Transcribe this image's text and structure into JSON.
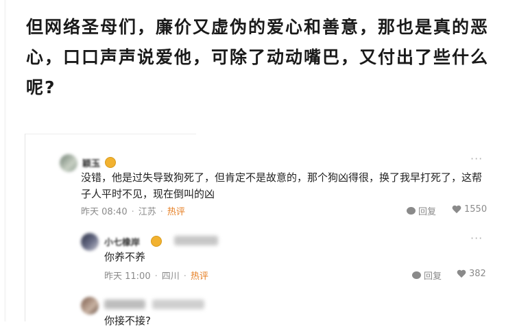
{
  "headline": "但网络圣母们，廉价又虚伪的爱心和善意，那也是真的恶心，口口声声说爱他，可除了动动嘴巴，又付出了些什么呢?",
  "comment1": {
    "name": "颖玉",
    "text": "没错，他是过失导致狗死了，但肯定不是故意的，那个狗凶得很，换了我早打死了，这帮子人平时不见，现在倒叫的凶",
    "time": "昨天 08:40",
    "location": "江苏",
    "hot": "热评",
    "reply_label": "回复",
    "likes": "1550"
  },
  "reply1": {
    "name": "小七橡岸",
    "text": "你养不养",
    "time": "昨天 11:00",
    "location": "四川",
    "hot": "热评",
    "reply_label": "回复",
    "likes": "382"
  },
  "reply2": {
    "text": "你接不接?"
  },
  "more_icon": "···",
  "colors": {
    "hot": "#e67e22",
    "meta": "#8a8a8a",
    "badge": "#f2b230"
  }
}
